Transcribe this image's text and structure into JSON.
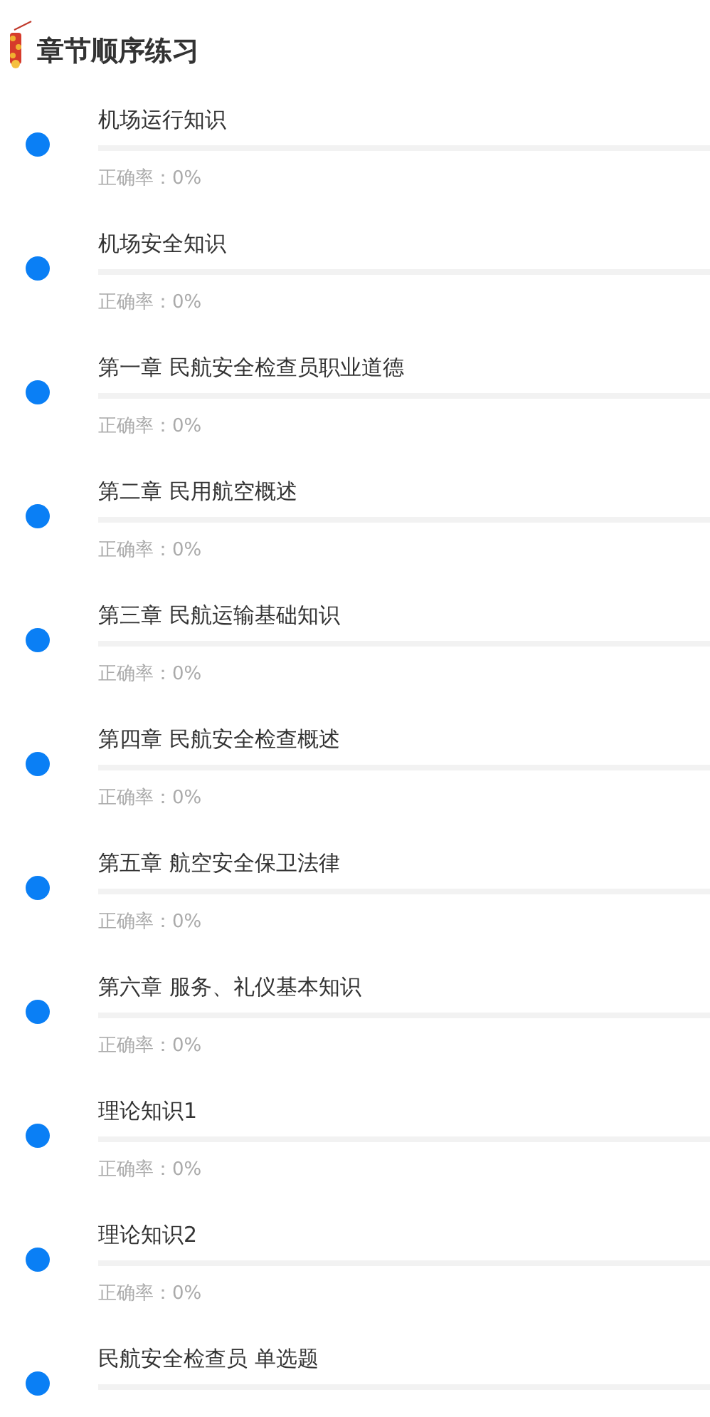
{
  "header": {
    "title": "章节顺序练习"
  },
  "chapters": [
    {
      "name": "机场运行知识",
      "accuracy": "正确率：0%"
    },
    {
      "name": "机场安全知识",
      "accuracy": "正确率：0%"
    },
    {
      "name": "第一章 民航安全检查员职业道德",
      "accuracy": "正确率：0%"
    },
    {
      "name": "第二章 民用航空概述",
      "accuracy": "正确率：0%"
    },
    {
      "name": "第三章 民航运输基础知识",
      "accuracy": "正确率：0%"
    },
    {
      "name": "第四章 民航安全检查概述",
      "accuracy": "正确率：0%"
    },
    {
      "name": "第五章 航空安全保卫法律",
      "accuracy": "正确率：0%"
    },
    {
      "name": "第六章 服务、礼仪基本知识",
      "accuracy": "正确率：0%"
    },
    {
      "name": "理论知识1",
      "accuracy": "正确率：0%"
    },
    {
      "name": "理论知识2",
      "accuracy": "正确率：0%"
    },
    {
      "name": "民航安全检查员 单选题"
    }
  ]
}
